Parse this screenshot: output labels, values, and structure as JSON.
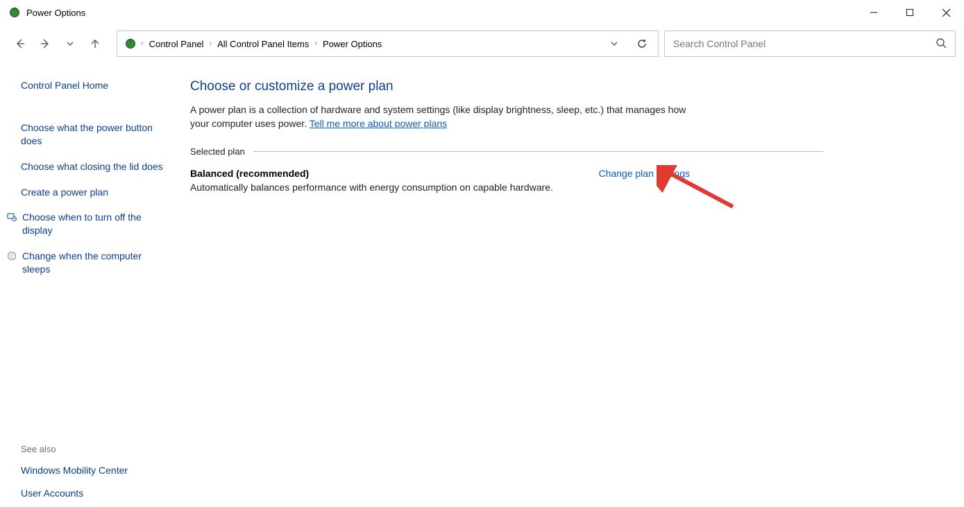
{
  "window": {
    "title": "Power Options"
  },
  "breadcrumbs": {
    "item1": "Control Panel",
    "item2": "All Control Panel Items",
    "item3": "Power Options"
  },
  "search": {
    "placeholder": "Search Control Panel"
  },
  "sidebar": {
    "home": "Control Panel Home",
    "links": {
      "powerButton": "Choose what the power button does",
      "closingLid": "Choose what closing the lid does",
      "createPlan": "Create a power plan",
      "turnOffDisplay": "Choose when to turn off the display",
      "computerSleeps": "Change when the computer sleeps"
    },
    "seeAlso": {
      "label": "See also",
      "mobility": "Windows Mobility Center",
      "userAccounts": "User Accounts"
    }
  },
  "main": {
    "title": "Choose or customize a power plan",
    "description": "A power plan is a collection of hardware and system settings (like display brightness, sleep, etc.) that manages how your computer uses power. ",
    "learnMore": "Tell me more about power plans",
    "selectedPlanLabel": "Selected plan",
    "plan": {
      "name": "Balanced (recommended)",
      "desc": "Automatically balances performance with energy consumption on capable hardware.",
      "changeLink": "Change plan settings"
    }
  }
}
